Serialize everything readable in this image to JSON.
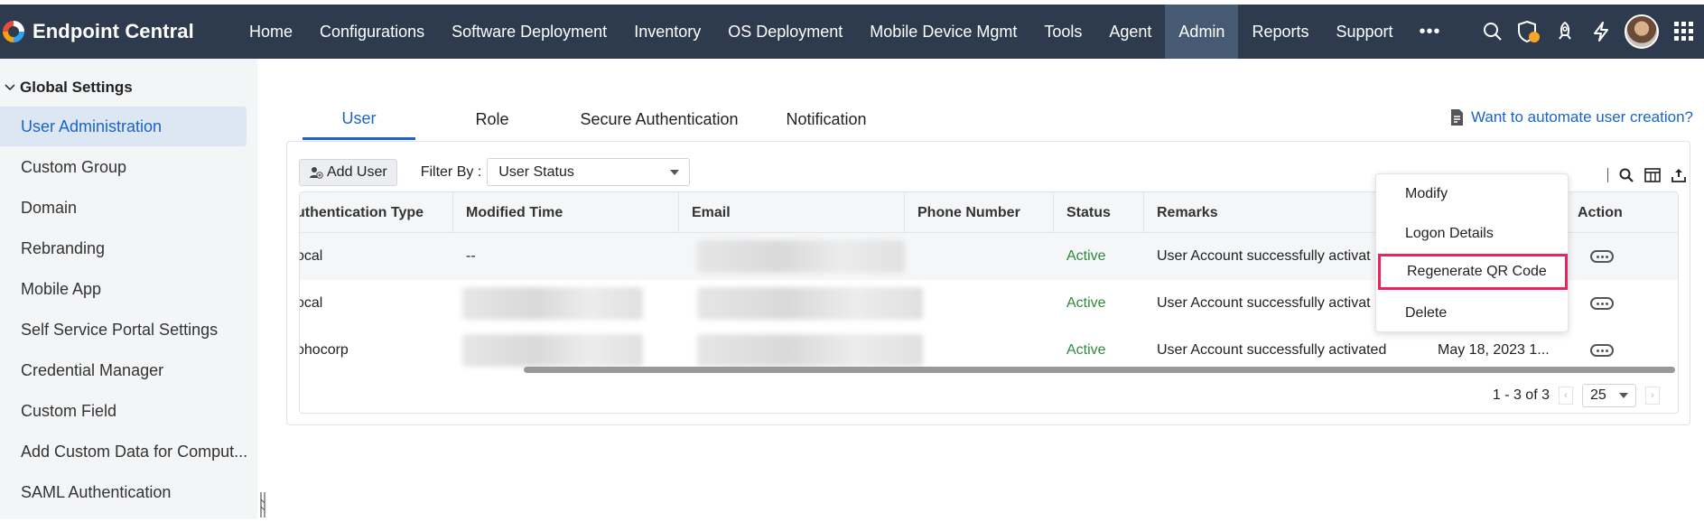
{
  "app": {
    "name": "Endpoint Central"
  },
  "nav": {
    "items": [
      {
        "label": "Home"
      },
      {
        "label": "Configurations"
      },
      {
        "label": "Software Deployment"
      },
      {
        "label": "Inventory"
      },
      {
        "label": "OS Deployment"
      },
      {
        "label": "Mobile Device Mgmt"
      },
      {
        "label": "Tools"
      },
      {
        "label": "Agent"
      },
      {
        "label": "Admin"
      },
      {
        "label": "Reports"
      },
      {
        "label": "Support"
      }
    ],
    "more": "•••",
    "active": "Admin"
  },
  "sidebar": {
    "group": "Global Settings",
    "items": [
      {
        "label": "User Administration"
      },
      {
        "label": "Custom Group"
      },
      {
        "label": "Domain"
      },
      {
        "label": "Rebranding"
      },
      {
        "label": "Mobile App"
      },
      {
        "label": "Self Service Portal Settings"
      },
      {
        "label": "Credential Manager"
      },
      {
        "label": "Custom Field"
      },
      {
        "label": "Add Custom Data for Comput..."
      },
      {
        "label": "SAML Authentication"
      }
    ]
  },
  "tabs": [
    {
      "label": "User"
    },
    {
      "label": "Role"
    },
    {
      "label": "Secure Authentication"
    },
    {
      "label": "Notification"
    }
  ],
  "automate_link": "Want to automate user creation?",
  "toolbar": {
    "add_user": "Add User",
    "filter_label": "Filter By :",
    "filter_value": "User Status"
  },
  "table": {
    "columns": [
      "uthentication Type",
      "Modified Time",
      "Email",
      "Phone Number",
      "Status",
      "Remarks",
      "Action"
    ],
    "rows": [
      {
        "auth": "ocal",
        "modified": "--",
        "status": "Active",
        "remarks": "User Account successfully activat",
        "logon": ""
      },
      {
        "auth": "ocal",
        "modified": "",
        "status": "Active",
        "remarks": "User Account successfully activat",
        "logon": ""
      },
      {
        "auth": "ohocorp",
        "modified": "",
        "status": "Active",
        "remarks": "User Account successfully activated",
        "logon": "May 18, 2023 1..."
      }
    ]
  },
  "pager": {
    "range": "1 - 3 of 3",
    "page_size": "25"
  },
  "context_menu": {
    "items": [
      {
        "label": "Modify"
      },
      {
        "label": "Logon Details"
      },
      {
        "label": "Regenerate QR Code"
      },
      {
        "label": "Delete"
      }
    ],
    "highlight_color": "#e8245a"
  },
  "colors": {
    "nav_bg": "#2e3b4e",
    "nav_active": "#475a73",
    "accent": "#1a64c8",
    "status_active": "#2e8b3c"
  }
}
